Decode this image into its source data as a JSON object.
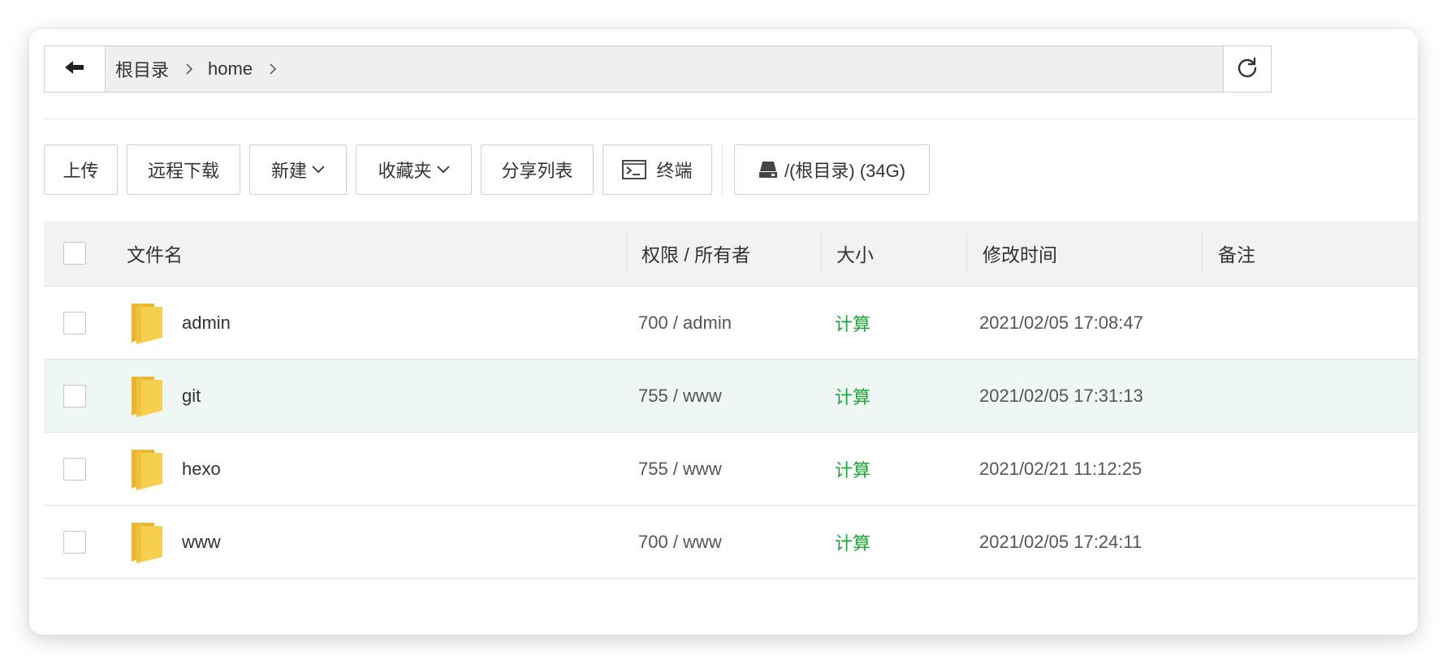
{
  "breadcrumb": {
    "items": [
      "根目录",
      "home"
    ]
  },
  "toolbar": {
    "upload": "上传",
    "remote_download": "远程下载",
    "new": "新建",
    "favorites": "收藏夹",
    "share_list": "分享列表",
    "terminal": "终端",
    "disk": "/(根目录) (34G)"
  },
  "table": {
    "headers": {
      "name": "文件名",
      "perm_owner": "权限 / 所有者",
      "size": "大小",
      "mtime": "修改时间",
      "note": "备注"
    },
    "rows": [
      {
        "name": "admin",
        "perm": "700 / admin",
        "size": "计算",
        "mtime": "2021/02/05 17:08:47"
      },
      {
        "name": "git",
        "perm": "755 / www",
        "size": "计算",
        "mtime": "2021/02/05 17:31:13"
      },
      {
        "name": "hexo",
        "perm": "755 / www",
        "size": "计算",
        "mtime": "2021/02/21 11:12:25"
      },
      {
        "name": "www",
        "perm": "700 / www",
        "size": "计算",
        "mtime": "2021/02/05 17:24:11"
      }
    ]
  },
  "colors": {
    "accent_green": "#20a53a",
    "folder_yellow": "#f4c542",
    "highlight_row": "#eef7f3"
  },
  "icons": {
    "back": "arrow-left-icon",
    "refresh": "refresh-icon",
    "folder": "folder-icon",
    "terminal": "terminal-icon",
    "disk": "disk-icon",
    "chevron": "chevron-down-icon",
    "separator": "chevron-right-icon"
  }
}
